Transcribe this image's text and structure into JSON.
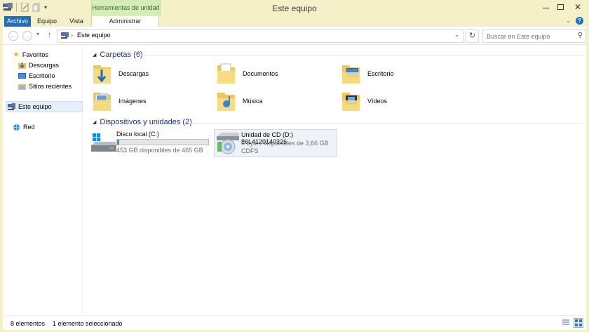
{
  "window": {
    "title": "Este equipo",
    "context_tab_group": "Herramientas de unidad"
  },
  "ribbon": {
    "tabs": [
      {
        "label": "Archivo"
      },
      {
        "label": "Equipo"
      },
      {
        "label": "Vista"
      },
      {
        "label": "Administrar"
      }
    ],
    "help": "?"
  },
  "nav_bar": {
    "address": "Este equipo",
    "search": {
      "placeholder": "Buscar en Este equipo",
      "value": ""
    }
  },
  "sidebar": {
    "items": [
      {
        "label": "Favoritos",
        "icon": "star-icon"
      },
      {
        "label": "Descargas",
        "icon": "downloads-icon"
      },
      {
        "label": "Escritorio",
        "icon": "desktop-icon"
      },
      {
        "label": "Sitios recientes",
        "icon": "recent-places-icon"
      },
      {
        "label": "Este equipo",
        "icon": "computer-icon",
        "selected": true
      },
      {
        "label": "Red",
        "icon": "network-icon"
      }
    ]
  },
  "main": {
    "folders_header": "Carpetas (6)",
    "folders": [
      {
        "label": "Descargas",
        "icon": "downloads-folder-icon"
      },
      {
        "label": "Documentos",
        "icon": "documents-folder-icon"
      },
      {
        "label": "Escritorio",
        "icon": "desktop-folder-icon"
      },
      {
        "label": "Imágenes",
        "icon": "pictures-folder-icon"
      },
      {
        "label": "Música",
        "icon": "music-folder-icon"
      },
      {
        "label": "Vídeos",
        "icon": "videos-folder-icon"
      }
    ],
    "devices_header": "Dispositivos y unidades (2)",
    "devices": [
      {
        "name": "Disco local (C:)",
        "detail": "453 GB disponibles de 465 GB",
        "used_fraction": 0.026,
        "icon": "local-disk-icon"
      },
      {
        "name": "Unidad de CD (D:) 86L4120140326",
        "detail": "0 bytes disponibles de 3,66 GB",
        "filesystem": "CDFS",
        "icon": "cd-drive-icon",
        "selected": true
      }
    ]
  },
  "status": {
    "count": "8 elementos",
    "selection": "1 elemento seleccionado"
  },
  "colors": {
    "accent": "#1a6fbf",
    "titlebar": "#f6f0c8",
    "context_tab": "#d5ecb8",
    "group_header": "#1e3287",
    "drive_bar": "#26a0da"
  }
}
